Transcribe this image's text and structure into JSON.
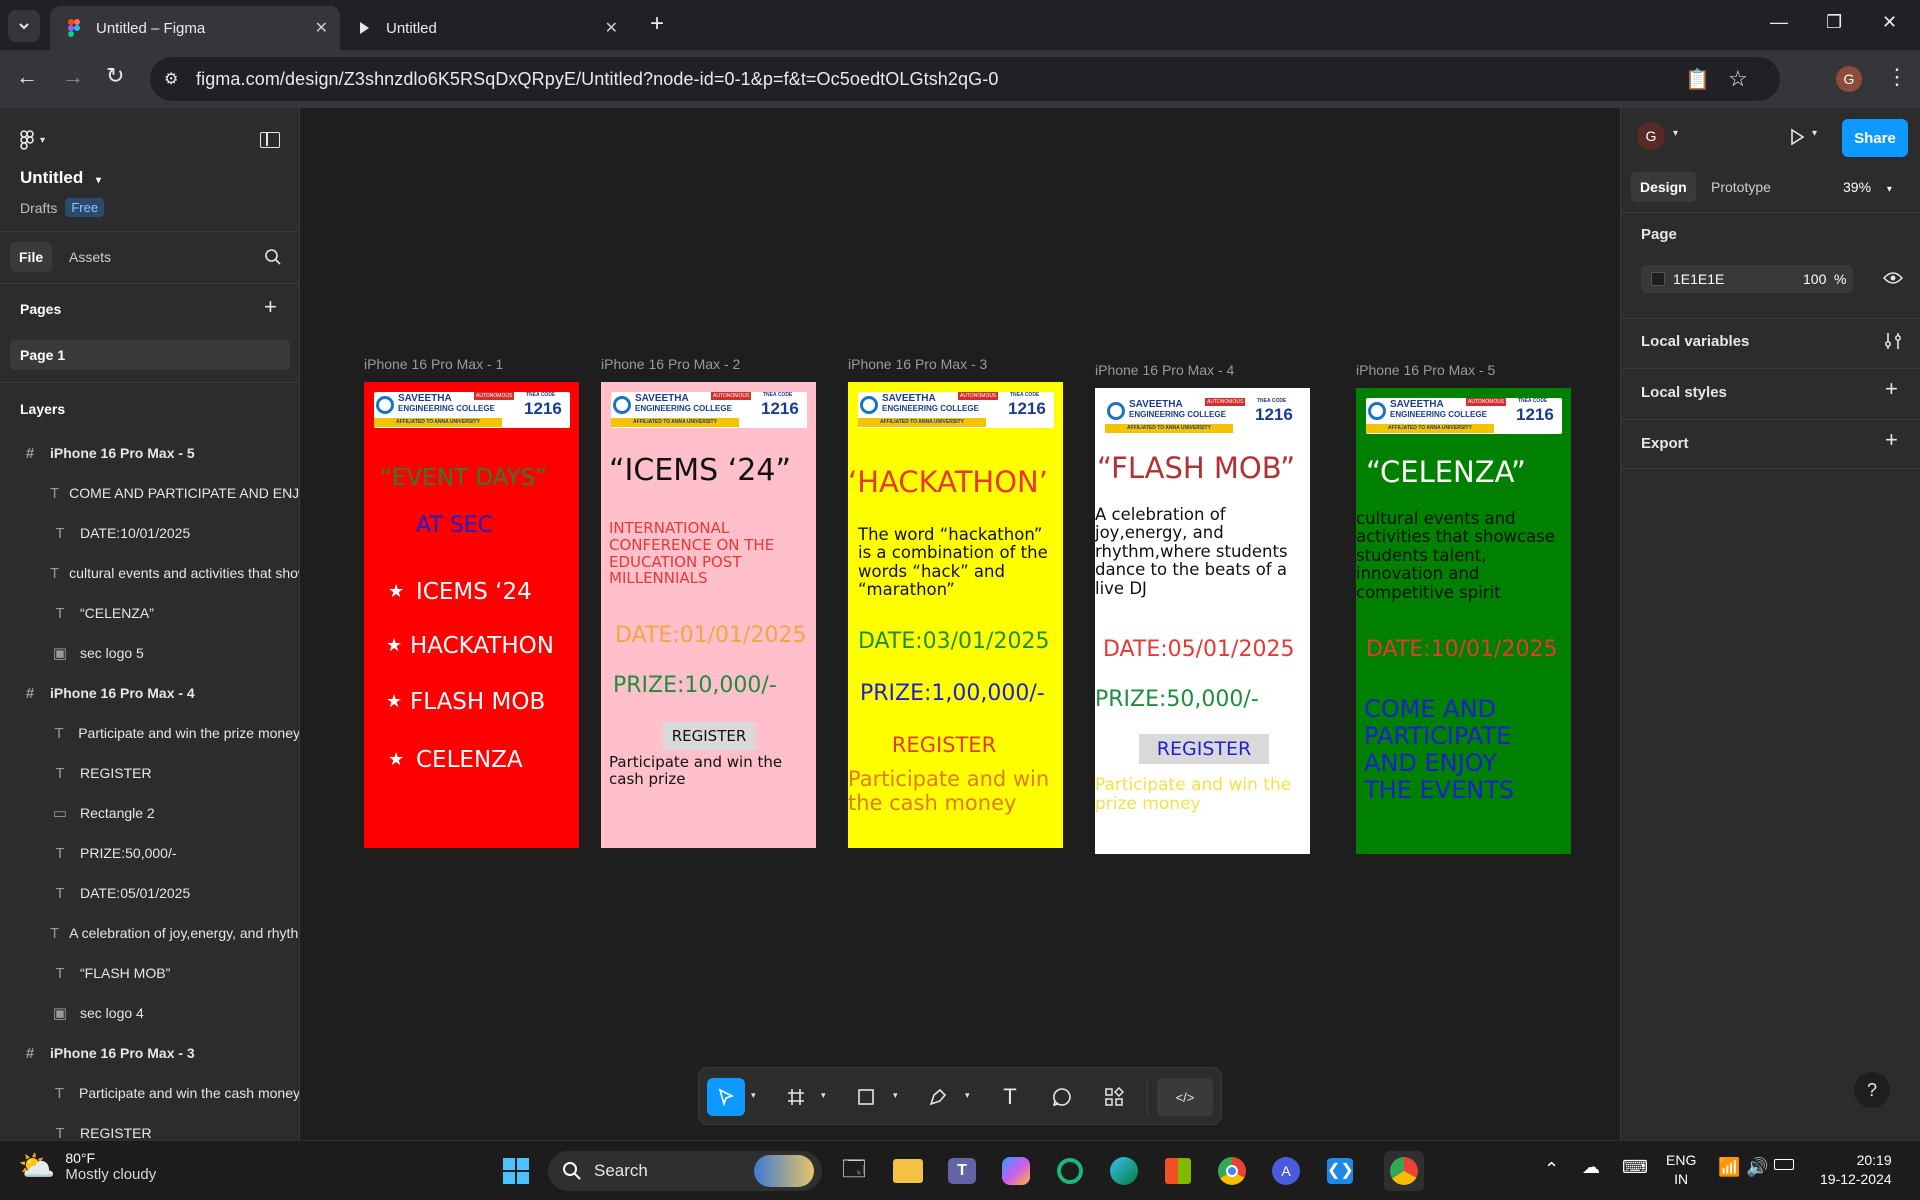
{
  "browser": {
    "tabs": [
      {
        "title": "Untitled – Figma",
        "active": true,
        "icon": "figma-icon"
      },
      {
        "title": "Untitled",
        "active": false,
        "icon": "play-icon"
      }
    ],
    "url": "figma.com/design/Z3shnzdlo6K5RSqDxQRpyE/Untitled?node-id=0-1&p=f&t=Oc5oedtOLGtsh2qG-0",
    "profile_initial": "G"
  },
  "figma": {
    "file_name": "Untitled",
    "drafts_label": "Drafts",
    "plan_badge": "Free",
    "tabs": {
      "file": "File",
      "assets": "Assets"
    },
    "pages_heading": "Pages",
    "pages": [
      "Page 1"
    ],
    "layers_heading": "Layers",
    "layers": [
      {
        "type": "frame",
        "name": "iPhone 16 Pro Max - 5"
      },
      {
        "type": "text",
        "name": "COME AND PARTICIPATE AND ENJOY THE EVENTS"
      },
      {
        "type": "text",
        "name": "DATE:10/01/2025"
      },
      {
        "type": "text",
        "name": "cultural events and activities that showcase"
      },
      {
        "type": "text",
        "name": "“CELENZA”"
      },
      {
        "type": "image",
        "name": "sec logo 5"
      },
      {
        "type": "frame",
        "name": "iPhone 16 Pro Max - 4"
      },
      {
        "type": "text",
        "name": "Participate and win the prize money"
      },
      {
        "type": "text",
        "name": "REGISTER"
      },
      {
        "type": "rect",
        "name": "Rectangle 2"
      },
      {
        "type": "text",
        "name": "PRIZE:50,000/-"
      },
      {
        "type": "text",
        "name": "DATE:05/01/2025"
      },
      {
        "type": "text",
        "name": "A celebration of joy,energy, and rhythm"
      },
      {
        "type": "text",
        "name": "“FLASH MOB”"
      },
      {
        "type": "image",
        "name": "sec logo 4"
      },
      {
        "type": "frame",
        "name": "iPhone 16 Pro Max - 3"
      },
      {
        "type": "text",
        "name": "Participate and win the cash money"
      },
      {
        "type": "text",
        "name": "REGISTER"
      }
    ],
    "right_panel": {
      "avatar": "G",
      "share": "Share",
      "tab_design": "Design",
      "tab_prototype": "Prototype",
      "zoom": "39%",
      "page_heading": "Page",
      "bg_color": "1E1E1E",
      "bg_opacity": "100",
      "percent_sign": "%",
      "local_variables": "Local variables",
      "local_styles": "Local styles",
      "export": "Export"
    },
    "help": "?"
  },
  "frames": [
    {
      "label": "iPhone 16 Pro Max - 1",
      "bg": "#ff0000",
      "title": "“EVENT DAYS”",
      "subtitle": "AT SEC",
      "items": [
        "ICEMS ‘24",
        "HACKATHON",
        "FLASH MOB",
        "CELENZA"
      ],
      "star": "★"
    },
    {
      "label": "iPhone 16 Pro Max - 2",
      "bg": "#ffc0cb",
      "title": "“ICEMS ‘24”",
      "desc": "INTERNATIONAL\nCONFERENCE ON THE\nEDUCATION POST\nMILLENNIALS",
      "date": "DATE:01/01/2025",
      "prize": "PRIZE:10,000/-",
      "register": "REGISTER",
      "cta": "Participate and win the\ncash prize"
    },
    {
      "label": "iPhone 16 Pro Max - 3",
      "bg": "#ffff00",
      "title": "‘HACKATHON’",
      "desc": "The word “hackathon”\nis a combination of the\nwords “hack” and\n“marathon”",
      "date": "DATE:03/01/2025",
      "prize": "PRIZE:1,00,000/-",
      "register": "REGISTER",
      "cta": "Participate and win\nthe cash money"
    },
    {
      "label": "iPhone 16 Pro Max - 4",
      "bg": "#ffffff",
      "title": "“FLASH MOB”",
      "desc": "A celebration of\njoy,energy, and\nrhythm,where students\ndance to the beats of a\nlive DJ",
      "date": "DATE:05/01/2025",
      "prize": "PRIZE:50,000/-",
      "register": "REGISTER",
      "cta": "Participate and win the\nprize money"
    },
    {
      "label": "iPhone 16 Pro Max - 5",
      "bg": "#008000",
      "title": "“CELENZA”",
      "desc": "cultural events and\nactivities that showcase\nstudents talent,\ninnovation and\ncompetitive spirit",
      "date": "DATE:10/01/2025",
      "cta": "COME AND\nPARTICIPATE\nAND ENJOY\nTHE EVENTS"
    }
  ],
  "logo": {
    "name": "SAVEETHA",
    "college": "ENGINEERING COLLEGE",
    "autonomous": "AUTONOMOUS",
    "affiliated": "AFFILIATED TO ANNA UNIVERSITY",
    "tnea": "TNEA CODE",
    "code": "1216"
  },
  "taskbar": {
    "weather_temp": "80°F",
    "weather_desc": "Mostly cloudy",
    "search": "Search",
    "lang1": "ENG",
    "lang2": "IN",
    "time": "20:19",
    "date": "19-12-2024"
  },
  "colors": {
    "accent": "#0d99ff",
    "canvas": "#1e1e1e",
    "panel": "#2c2c2c"
  }
}
